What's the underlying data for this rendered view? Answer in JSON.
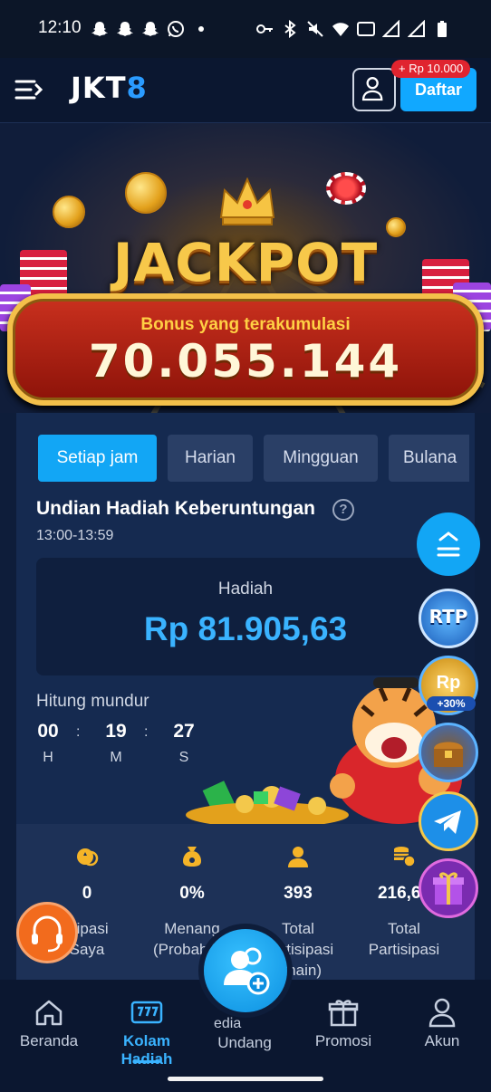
{
  "status_bar": {
    "time": "12:10",
    "left_icons": [
      "snapchat-icon",
      "snapchat-icon",
      "snapchat-icon",
      "whatsapp-icon",
      "dot-icon"
    ],
    "right_icons": [
      "key-icon",
      "bluetooth-icon",
      "mute-icon",
      "wifi-icon",
      "vowifi-icon",
      "signal-icon",
      "signal-icon",
      "battery-icon"
    ]
  },
  "header": {
    "logo_text": "JKT",
    "logo_accent": "8",
    "register_label": "Daftar",
    "register_badge": "+ Rp 10.000"
  },
  "jackpot": {
    "title": "JACKPOT",
    "label": "Bonus yang terakumulasi",
    "amount": "70.055.144"
  },
  "tabs": [
    {
      "label": "Setiap jam",
      "active": true
    },
    {
      "label": "Harian",
      "active": false
    },
    {
      "label": "Mingguan",
      "active": false
    },
    {
      "label": "Bulana",
      "active": false
    }
  ],
  "draw": {
    "title": "Undian Hadiah Keberuntungan",
    "help": "?",
    "time_range": "13:00-13:59",
    "prize_label": "Hadiah",
    "prize_value": "Rp 81.905,63",
    "countdown_label": "Hitung mundur",
    "countdown": {
      "hours": "00",
      "minutes": "19",
      "seconds": "27",
      "hours_unit": "H",
      "minutes_unit": "M",
      "seconds_unit": "S",
      "sep": ":"
    }
  },
  "floating": {
    "rtp_label": "RTP",
    "rp_label": "Rp",
    "rp_badge": "+30%"
  },
  "stats": [
    {
      "icon": "participation-icon",
      "value": "0",
      "label": "isipasi\nSaya"
    },
    {
      "icon": "probability-icon",
      "value": "0%",
      "label": "Menang\n(Probabilita"
    },
    {
      "icon": "player-icon",
      "value": "393",
      "label": "Total\nPartisipasi\nemain)"
    },
    {
      "icon": "coins-icon",
      "value": "216,63",
      "label": "Total\nPartisipasi"
    }
  ],
  "bottom_nav": [
    {
      "label": "Beranda",
      "icon": "home-icon",
      "active": false
    },
    {
      "label": "Kolam Hadiah",
      "icon": "slot-icon",
      "active": true
    },
    {
      "label": "Undang",
      "icon": "invite-icon",
      "active": false,
      "partial_label": "edia"
    },
    {
      "label": "Promosi",
      "icon": "gift-icon",
      "active": false
    },
    {
      "label": "Akun",
      "icon": "account-icon",
      "active": false
    }
  ],
  "colors": {
    "accent": "#12a6f5",
    "background": "#0e1d3a",
    "card": "#152a50",
    "prize": "#3ab3ff",
    "jackpot_gold": "#f7c84a",
    "badge_red": "#e0242f"
  }
}
